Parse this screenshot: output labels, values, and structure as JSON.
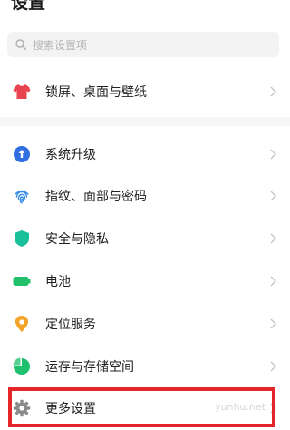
{
  "header": {
    "title": "设置"
  },
  "search": {
    "placeholder": "搜索设置项"
  },
  "items": [
    {
      "label": "锁屏、桌面与壁纸",
      "icon": "shirt-icon",
      "color": "#e8444f"
    },
    {
      "label": "系统升级",
      "icon": "upgrade-arrow-icon",
      "color": "#2f6fe0"
    },
    {
      "label": "指纹、面部与密码",
      "icon": "fingerprint-icon",
      "color": "#3b8ee8"
    },
    {
      "label": "安全与隐私",
      "icon": "shield-icon",
      "color": "#18c19a"
    },
    {
      "label": "电池",
      "icon": "battery-icon",
      "color": "#22c06b"
    },
    {
      "label": "定位服务",
      "icon": "location-pin-icon",
      "color": "#f2a52a"
    },
    {
      "label": "运存与存储空间",
      "icon": "pie-chart-icon",
      "color": "#1fc06e"
    },
    {
      "label": "更多设置",
      "icon": "gear-icon",
      "color": "#8a8a8a"
    }
  ],
  "highlight_color": "#e4262b",
  "watermark": "yunhu.net"
}
